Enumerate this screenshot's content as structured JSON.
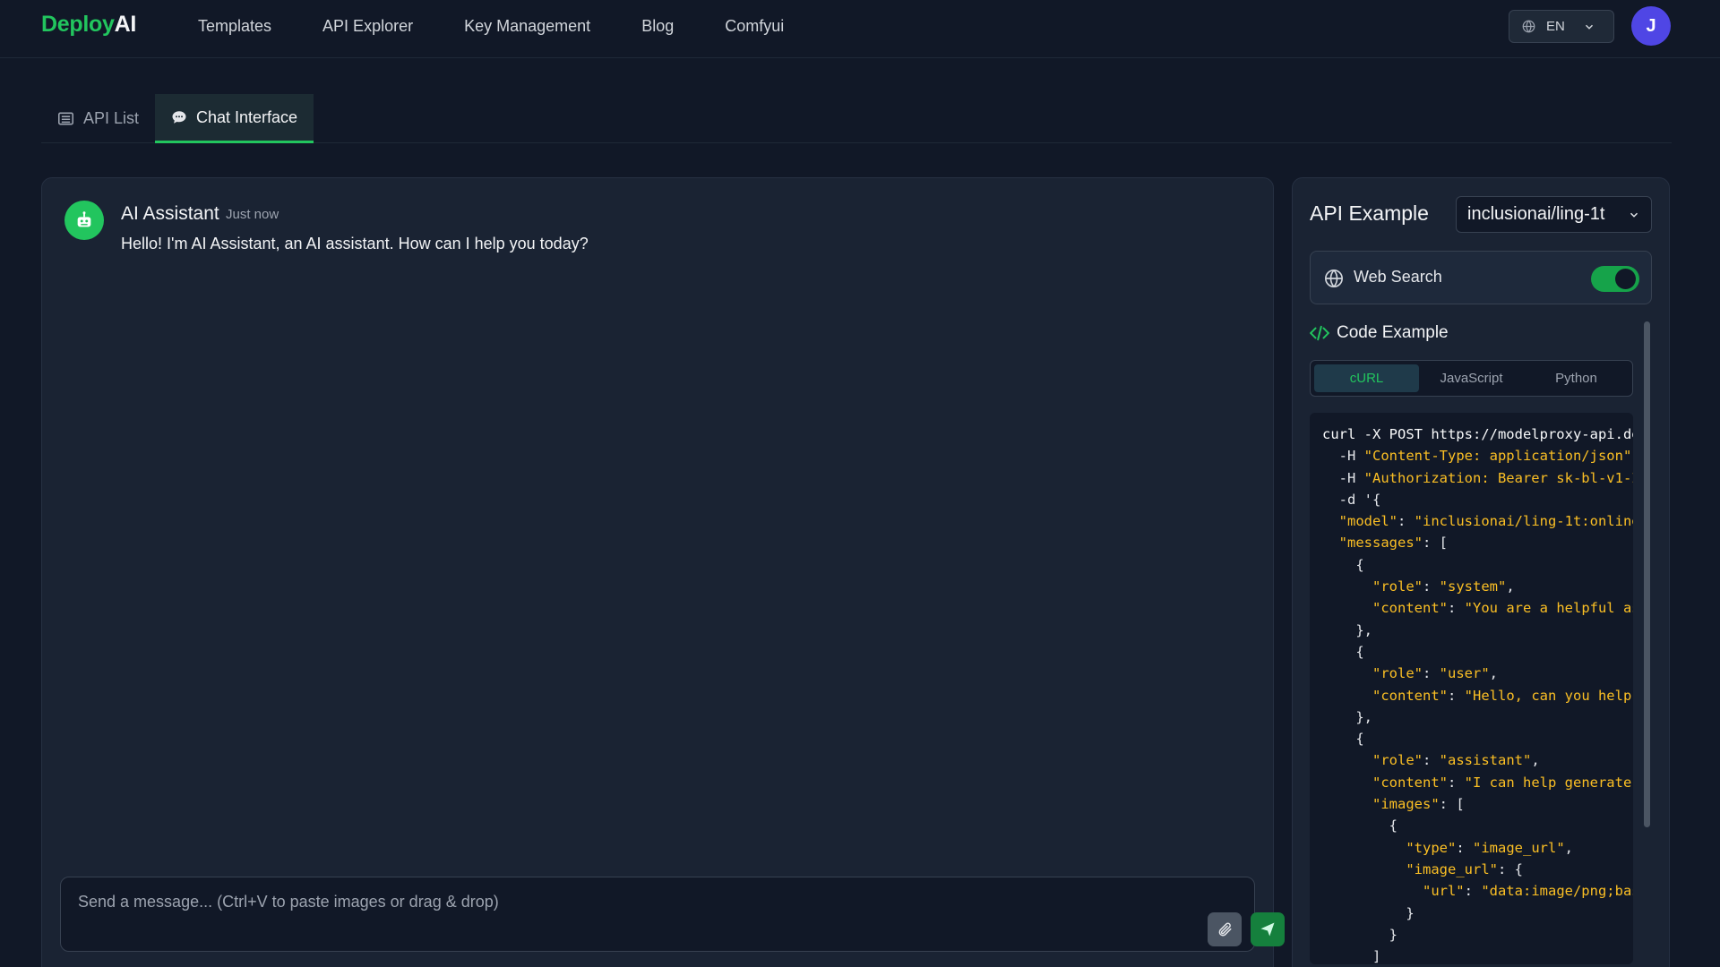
{
  "app": {
    "logo_part1": "Deploy",
    "logo_part2": "AI",
    "brand_color": "#22c55e"
  },
  "nav": {
    "links": [
      "Templates",
      "API Explorer",
      "Key Management",
      "Blog",
      "Comfyui"
    ],
    "language": "EN",
    "avatar_initial": "J"
  },
  "tabs": {
    "api_list": "API List",
    "chat_interface": "Chat Interface",
    "active": "chat_interface"
  },
  "chat": {
    "assistant_name": "AI Assistant",
    "timestamp": "Just now",
    "message": "Hello! I'm AI Assistant, an AI assistant. How can I help you today?",
    "input_placeholder": "Send a message... (Ctrl+V to paste images or drag & drop)"
  },
  "api_panel": {
    "title": "API Example",
    "model": "inclusionai/ling-1t",
    "web_search_label": "Web Search",
    "web_search_enabled": true,
    "code_heading": "Code Example",
    "code_tabs": [
      "cURL",
      "JavaScript",
      "Python"
    ],
    "active_code_tab": "cURL",
    "code_lines": [
      "curl -X POST https://modelproxy-api.de",
      "  -H \"Content-Type: application/json\"",
      "  -H \"Authorization: Bearer sk-bl-v1-I",
      "  -d '{",
      "  \"model\": \"inclusionai/ling-1t:online",
      "  \"messages\": [",
      "    {",
      "      \"role\": \"system\",",
      "      \"content\": \"You are a helpful as",
      "    },",
      "    {",
      "      \"role\": \"user\",",
      "      \"content\": \"Hello, can you help",
      "    },",
      "    {",
      "      \"role\": \"assistant\",",
      "      \"content\": \"I can help generate",
      "      \"images\": [",
      "        {",
      "          \"type\": \"image_url\",",
      "          \"image_url\": {",
      "            \"url\": \"data:image/png;bas",
      "          }",
      "        }",
      "      ]"
    ]
  }
}
